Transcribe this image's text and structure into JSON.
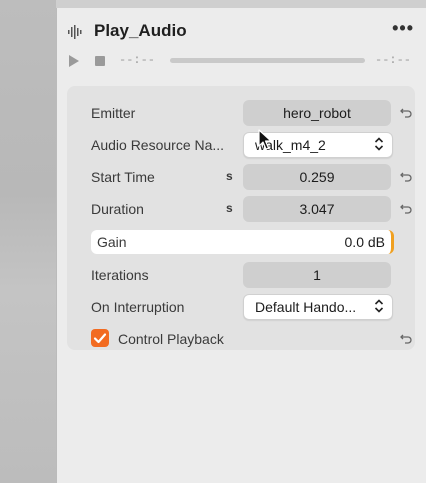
{
  "header": {
    "title": "Play_Audio",
    "more_label": "•••"
  },
  "transport": {
    "time_start": "--:--",
    "time_end": "--:--"
  },
  "fields": {
    "emitter": {
      "label": "Emitter",
      "value": "hero_robot"
    },
    "audio_resource": {
      "label": "Audio Resource Na...",
      "value": "walk_m4_2"
    },
    "start_time": {
      "label": "Start Time",
      "unit": "s",
      "value": "0.259"
    },
    "duration": {
      "label": "Duration",
      "unit": "s",
      "value": "3.047"
    },
    "gain": {
      "label": "Gain",
      "value": "0.0 dB"
    },
    "iterations": {
      "label": "Iterations",
      "value": "1"
    },
    "on_interruption": {
      "label": "On Interruption",
      "value": "Default Hando..."
    },
    "control_playback": {
      "label": "Control Playback",
      "checked": true
    }
  },
  "colors": {
    "accent": "#f26b21",
    "gain_marker": "#f0a020"
  },
  "icons": [
    "waveform-icon",
    "more-icon",
    "play-icon",
    "stop-icon",
    "reset-icon",
    "chevron-updown-icon",
    "checkmark-icon"
  ]
}
